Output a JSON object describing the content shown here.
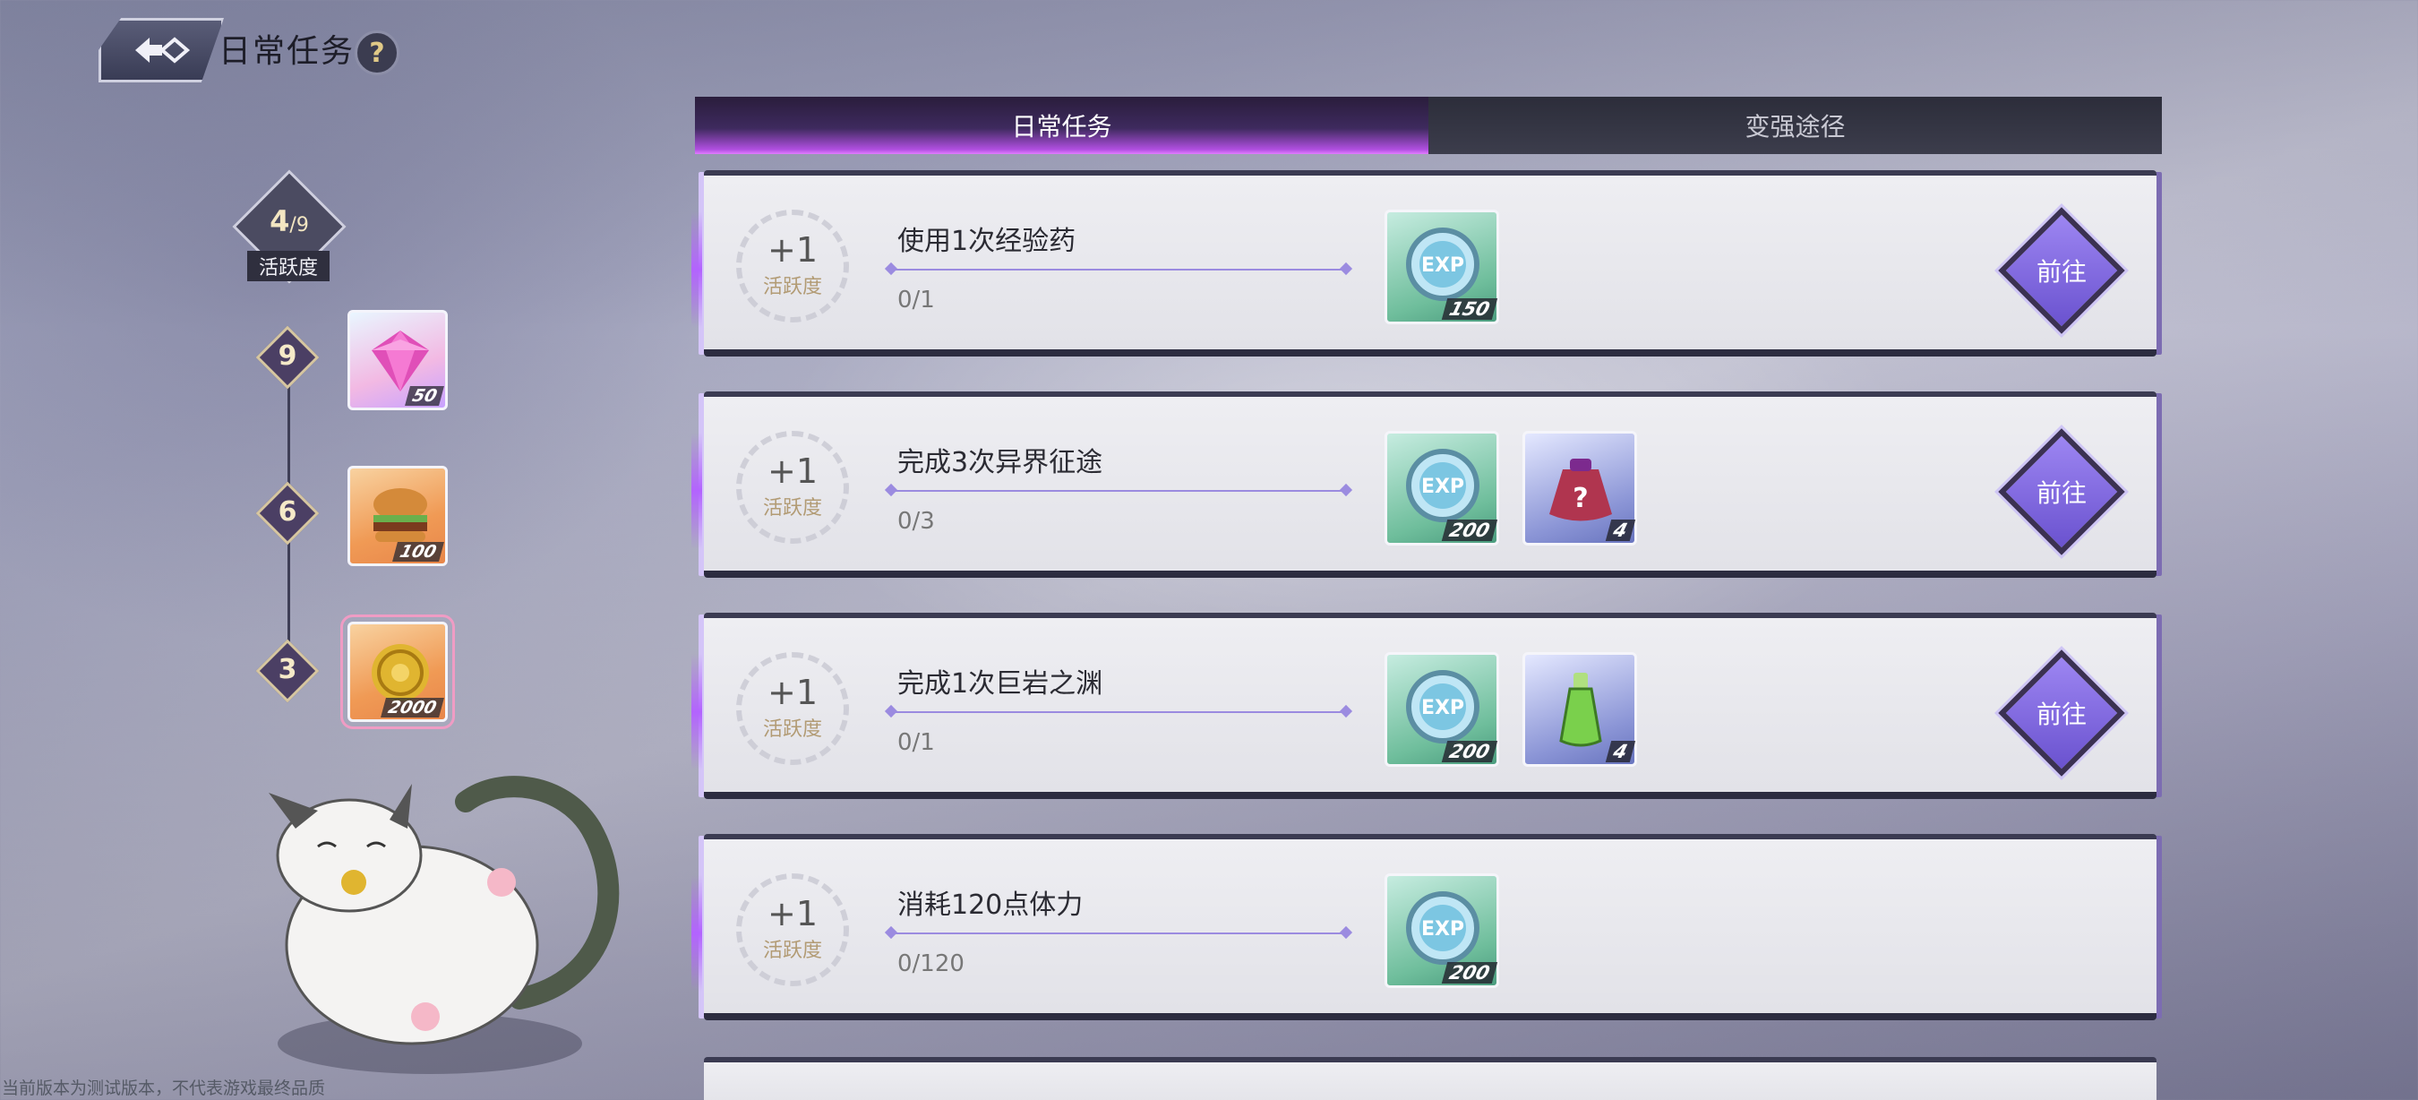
{
  "header": {
    "title": "日常任务",
    "help": "?"
  },
  "tabs": [
    {
      "label": "日常任务",
      "active": true
    },
    {
      "label": "变强途径",
      "active": false
    }
  ],
  "activity": {
    "current": "4",
    "max": "/9",
    "label": "活跃度",
    "milestones": [
      {
        "level": "9",
        "item": "pink-diamond",
        "qty": "50"
      },
      {
        "level": "6",
        "item": "burger",
        "qty": "100"
      },
      {
        "level": "3",
        "item": "gold-coin",
        "qty": "2000"
      }
    ]
  },
  "tasks": [
    {
      "plus": "+1",
      "points_label": "活跃度",
      "title": "使用1次经验药",
      "progress": "0/1",
      "rewards": [
        {
          "item": "exp-token",
          "qty": "150"
        }
      ],
      "button": "前往"
    },
    {
      "plus": "+1",
      "points_label": "活跃度",
      "title": "完成3次异界征途",
      "progress": "0/3",
      "rewards": [
        {
          "item": "exp-token",
          "qty": "200"
        },
        {
          "item": "mystery-bag",
          "qty": "4"
        }
      ],
      "button": "前往"
    },
    {
      "plus": "+1",
      "points_label": "活跃度",
      "title": "完成1次巨岩之渊",
      "progress": "0/1",
      "rewards": [
        {
          "item": "exp-token",
          "qty": "200"
        },
        {
          "item": "green-potion",
          "qty": "4"
        }
      ],
      "button": "前往"
    },
    {
      "plus": "+1",
      "points_label": "活跃度",
      "title": "消耗120点体力",
      "progress": "0/120",
      "rewards": [
        {
          "item": "exp-token",
          "qty": "200"
        }
      ]
    }
  ],
  "disclaimer": "当前版本为测试版本，不代表游戏最终品质",
  "colors": {
    "accent": "#b04fe0",
    "button": "#7e66df",
    "card": "#e8e8ee"
  }
}
